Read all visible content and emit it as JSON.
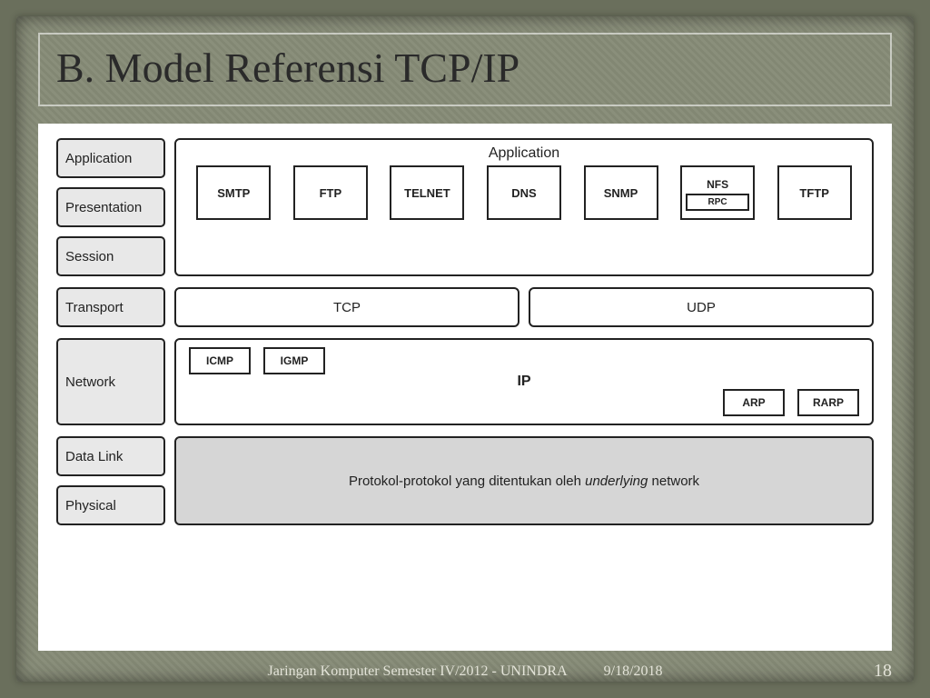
{
  "title": "B. Model Referensi TCP/IP",
  "layers": {
    "application": "Application",
    "presentation": "Presentation",
    "session": "Session",
    "transport": "Transport",
    "network": "Network",
    "datalink": "Data Link",
    "physical": "Physical"
  },
  "app_group": {
    "title": "Application",
    "protocols": [
      "SMTP",
      "FTP",
      "TELNET",
      "DNS",
      "SNMP"
    ],
    "nfs": "NFS",
    "rpc": "RPC",
    "tftp": "TFTP"
  },
  "transport": {
    "tcp": "TCP",
    "udp": "UDP"
  },
  "network": {
    "icmp": "ICMP",
    "igmp": "IGMP",
    "ip": "IP",
    "arp": "ARP",
    "rarp": "RARP"
  },
  "underlying_prefix": "Protokol-protokol yang ditentukan oleh ",
  "underlying_italic": "underlying",
  "underlying_suffix": " network",
  "footer": {
    "course": "Jaringan Komputer Semester IV/2012 - UNINDRA",
    "date": "9/18/2018",
    "page": "18"
  }
}
